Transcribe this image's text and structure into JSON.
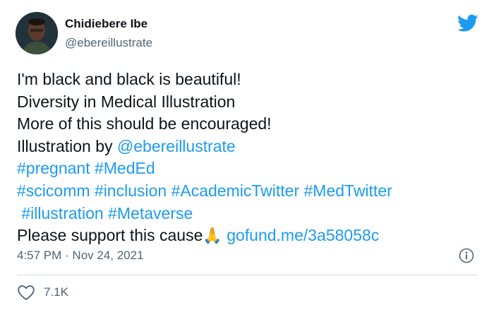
{
  "tweet": {
    "author_name": "Chidiebere Ibe",
    "author_handle": "@ebereillustrate",
    "body": {
      "line1": "I'm black and black is beautiful!",
      "line2": "Diversity in Medical Illustration",
      "line3": "More of this should be encouraged!",
      "line4_text": "Illustration by ",
      "line4_mention": "@ebereillustrate",
      "line5": [
        "#pregnant",
        "#MedEd"
      ],
      "line6": [
        "#scicomm",
        "#inclusion",
        "#AcademicTwitter",
        "#MedTwitter"
      ],
      "line7": [
        "#illustration",
        "#Metaverse"
      ],
      "line8_text": "Please support this cause",
      "line8_emoji": "🙏",
      "line8_link": "gofund.me/3a58058c"
    },
    "timestamp": "4:57 PM · Nov 24, 2021",
    "like_count": "7.1K"
  },
  "colors": {
    "link": "#1d9bf0",
    "text": "#0f1419",
    "muted": "#536471",
    "divider": "#cfd9de"
  },
  "icons": {
    "brand": "twitter-bird-icon",
    "info": "info-icon",
    "like": "heart-icon"
  }
}
